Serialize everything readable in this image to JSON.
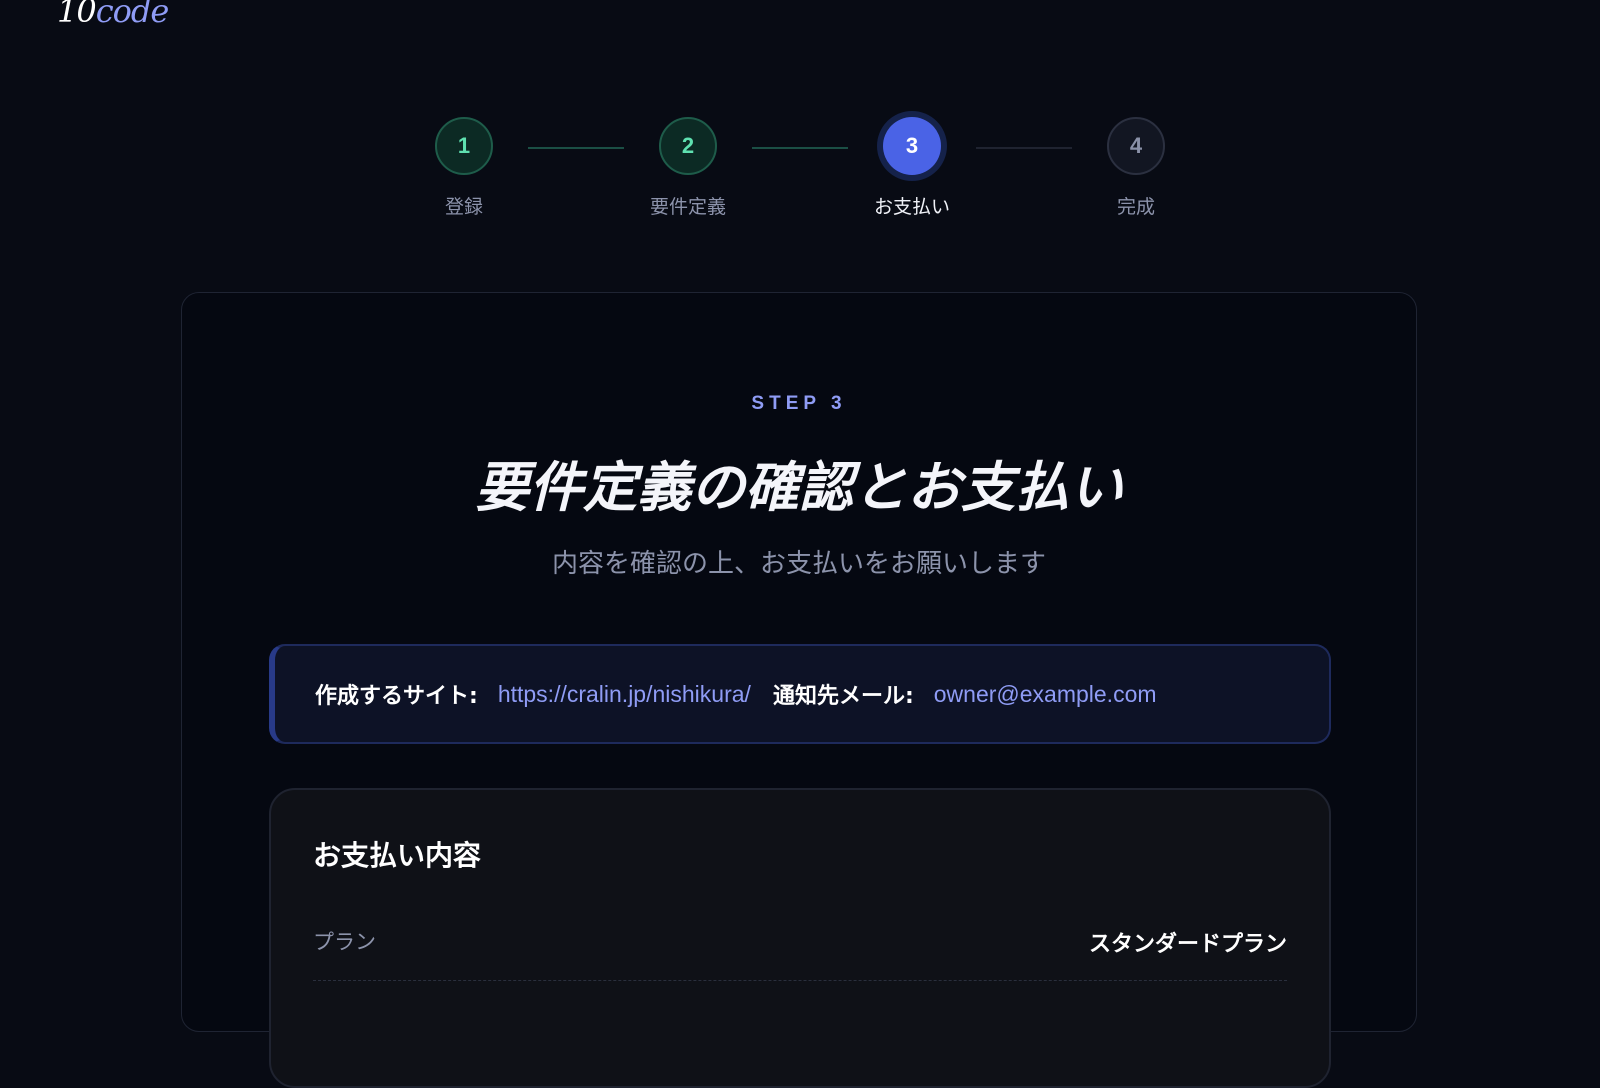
{
  "brand": {
    "logo_number": "10",
    "logo_word": "code"
  },
  "stepper": {
    "steps": [
      {
        "number": "1",
        "label": "登録",
        "state": "done"
      },
      {
        "number": "2",
        "label": "要件定義",
        "state": "done"
      },
      {
        "number": "3",
        "label": "お支払い",
        "state": "active"
      },
      {
        "number": "4",
        "label": "完成",
        "state": "todo"
      }
    ]
  },
  "main": {
    "eyebrow": "STEP 3",
    "title": "要件定義の確認とお支払い",
    "subtitle": "内容を確認の上、お支払いをお願いします",
    "info": {
      "site_label": "作成するサイト:",
      "site_value": "https://cralin.jp/nishikura/",
      "email_label": "通知先メール:",
      "email_value": "owner@example.com"
    },
    "payment": {
      "title": "お支払い内容",
      "rows": [
        {
          "label": "プラン",
          "value": "スタンダードプラン"
        }
      ]
    }
  },
  "colors": {
    "background": "#080b14",
    "accent": "#4a63e6",
    "accent_text": "#8f9cf5",
    "done": "#5fe0b0"
  }
}
